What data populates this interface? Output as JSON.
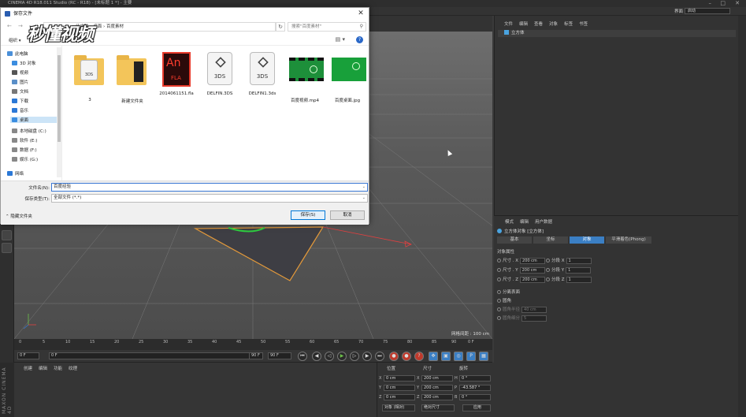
{
  "app": {
    "title": "CINEMA 4D R18.011 Studio (RC - R18) - [未标题 1 *] - 主要",
    "layout_label": "界面",
    "layout_value": "启动"
  },
  "viewport": {
    "scale_label": "网格间距 : 100 cm"
  },
  "timeline": {
    "ticks": [
      "0",
      "5",
      "10",
      "15",
      "20",
      "25",
      "30",
      "35",
      "40",
      "45",
      "50",
      "55",
      "60",
      "65",
      "70",
      "75",
      "80",
      "85",
      "90"
    ],
    "end_frame": "0 F",
    "current_frame": "0 F",
    "start_field": "0 F",
    "range_end": "90 F",
    "max_field": "90 F"
  },
  "material_manager": {
    "menu": [
      "创建",
      "编辑",
      "功能",
      "纹理"
    ],
    "brand": "MAXON CINEMA 4D"
  },
  "coordinates": {
    "headers": [
      "位置",
      "尺寸",
      "旋转"
    ],
    "rows": [
      {
        "axis": "X",
        "pos": "0 cm",
        "size": "200 cm",
        "rot_label": "H",
        "rot": "0 °"
      },
      {
        "axis": "Y",
        "pos": "0 cm",
        "size": "200 cm",
        "rot_label": "P",
        "rot": "-43.587 °"
      },
      {
        "axis": "Z",
        "pos": "0 cm",
        "size": "200 cm",
        "rot_label": "B",
        "rot": "0 °"
      }
    ],
    "mode_object": "对象 (相对)",
    "mode_size": "绝对尺寸",
    "apply": "应用"
  },
  "object_manager": {
    "menu": [
      "文件",
      "编辑",
      "查看",
      "对象",
      "标签",
      "书签"
    ],
    "object_name": "立方体"
  },
  "attribute_manager": {
    "menu": [
      "模式",
      "编辑",
      "用户数据"
    ],
    "object_label": "立方体对象 [立方体]",
    "tabs": [
      "基本",
      "坐标",
      "对象",
      "平滑着色(Phong)"
    ],
    "active_tab": 2,
    "section": "对象属性",
    "size_rows": [
      {
        "label": "尺寸 . X",
        "value": "200 cm",
        "seg_label": "分段 X",
        "seg": "1"
      },
      {
        "label": "尺寸 . Y",
        "value": "200 cm",
        "seg_label": "分段 Y",
        "seg": "1"
      },
      {
        "label": "尺寸 . Z",
        "value": "200 cm",
        "seg_label": "分段 Z",
        "seg": "1"
      }
    ],
    "separate_surfaces": "分离表面",
    "fillet": "圆角",
    "fillet_radius_label": "圆角半径",
    "fillet_radius": "40 cm",
    "fillet_subdiv_label": "圆角细分",
    "fillet_subdiv": "5"
  },
  "dialog": {
    "title": "保存文件",
    "breadcrumb": [
      "此电脑",
      "桌面",
      "百度素材"
    ],
    "search_placeholder": "搜索\"百度素材\"",
    "organize": "组织 ▾",
    "sidebar": [
      {
        "label": "此电脑",
        "color": "#4a8fd8"
      },
      {
        "label": "3D 对象",
        "color": "#3a8de0"
      },
      {
        "label": "视频",
        "color": "#555"
      },
      {
        "label": "图片",
        "color": "#5a8fc8"
      },
      {
        "label": "文档",
        "color": "#777"
      },
      {
        "label": "下载",
        "color": "#2b78d6"
      },
      {
        "label": "音乐",
        "color": "#2b78d6"
      },
      {
        "label": "桌面",
        "color": "#3a8de0"
      },
      {
        "label": "本地磁盘 (C:)",
        "color": "#888"
      },
      {
        "label": "软件 (E:)",
        "color": "#888"
      },
      {
        "label": "数据 (F:)",
        "color": "#888"
      },
      {
        "label": "娱乐 (G:)",
        "color": "#888"
      },
      {
        "label": "网络",
        "color": "#2b78d6"
      }
    ],
    "selected_sidebar": 7,
    "files": [
      {
        "name": "3",
        "kind": "folder3ds"
      },
      {
        "name": "新建文件夹",
        "kind": "folder"
      },
      {
        "name": "2014061151.fla",
        "kind": "fla"
      },
      {
        "name": "DELFIN.3DS",
        "kind": "3ds"
      },
      {
        "name": "DELFIN1.3ds",
        "kind": "3ds"
      },
      {
        "name": "百度视频.mp4",
        "kind": "video"
      },
      {
        "name": "百度桌面.jpg",
        "kind": "jpg"
      }
    ],
    "fla_big": "An",
    "fla_small": "FLA",
    "ds_label": "3DS",
    "filename_label": "文件名(N):",
    "filename_value": "百度经验",
    "filetype_label": "保存类型(T):",
    "filetype_value": "全部文件 (*.*)",
    "hide_folders": "隐藏文件夹",
    "save": "保存(S)",
    "cancel": "取消"
  },
  "watermark": "秒懂视频"
}
